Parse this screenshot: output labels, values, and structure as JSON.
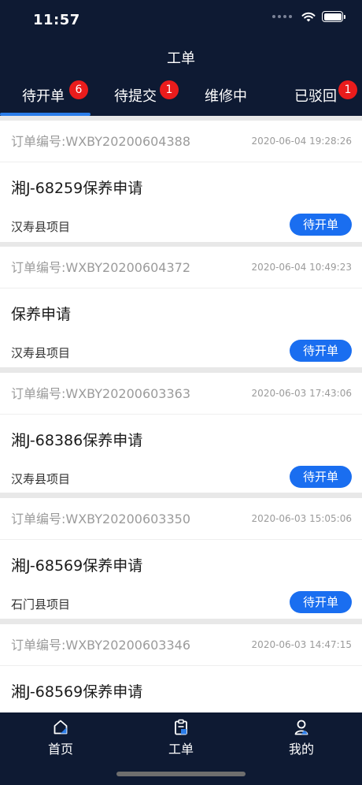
{
  "status_bar": {
    "time": "11:57"
  },
  "header": {
    "title": "工单"
  },
  "tabs": [
    {
      "label": "待开单",
      "badge": "6",
      "active": true
    },
    {
      "label": "待提交",
      "badge": "1",
      "active": false
    },
    {
      "label": "维修中",
      "badge": "",
      "active": false
    },
    {
      "label": "已驳回",
      "badge": "1",
      "active": false
    }
  ],
  "orders": [
    {
      "order_no": "订单编号:WXBY20200604388",
      "time": "2020-06-04 19:28:26",
      "title": "湘J-68259保养申请",
      "project": "汉寿县项目",
      "status": "待开单"
    },
    {
      "order_no": "订单编号:WXBY20200604372",
      "time": "2020-06-04 10:49:23",
      "title": "保养申请",
      "project": "汉寿县项目",
      "status": "待开单"
    },
    {
      "order_no": "订单编号:WXBY20200603363",
      "time": "2020-06-03 17:43:06",
      "title": "湘J-68386保养申请",
      "project": "汉寿县项目",
      "status": "待开单"
    },
    {
      "order_no": "订单编号:WXBY20200603350",
      "time": "2020-06-03 15:05:06",
      "title": "湘J-68569保养申请",
      "project": "石门县项目",
      "status": "待开单"
    },
    {
      "order_no": "订单编号:WXBY20200603346",
      "time": "2020-06-03 14:47:15",
      "title": "湘J-68569保养申请",
      "project": "",
      "status": ""
    }
  ],
  "bottom_nav": [
    {
      "label": "首页",
      "icon": "home-icon"
    },
    {
      "label": "工单",
      "icon": "clipboard-icon"
    },
    {
      "label": "我的",
      "icon": "user-icon"
    }
  ],
  "colors": {
    "header_bg": "#0e1a33",
    "accent": "#1a6ef0",
    "badge": "#ea1c1c",
    "indicator": "#2b7de9"
  }
}
